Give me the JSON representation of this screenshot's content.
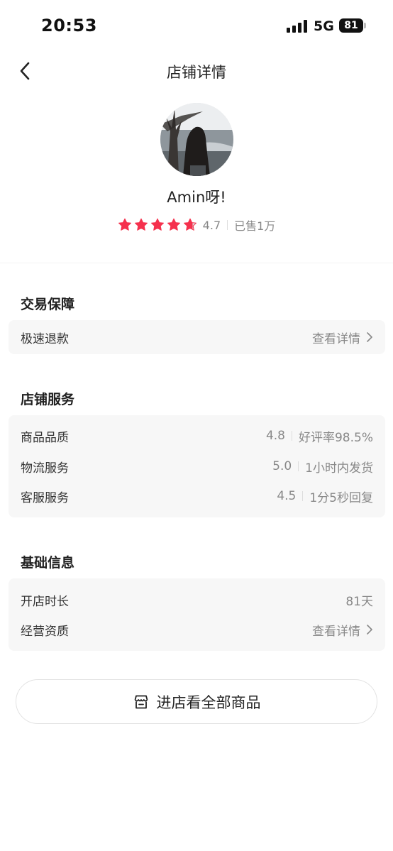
{
  "status_bar": {
    "time": "20:53",
    "network": "5G",
    "battery": "81"
  },
  "nav": {
    "title": "店铺详情"
  },
  "shop": {
    "name": "Amin呀!",
    "rating": "4.7",
    "stars": 4.7,
    "sold": "已售1万"
  },
  "guarantee": {
    "title": "交易保障",
    "item_label": "极速退款",
    "item_action": "查看详情"
  },
  "services": {
    "title": "店铺服务",
    "items": [
      {
        "label": "商品品质",
        "score": "4.8",
        "note": "好评率98.5%"
      },
      {
        "label": "物流服务",
        "score": "5.0",
        "note": "1小时内发货"
      },
      {
        "label": "客服服务",
        "score": "4.5",
        "note": "1分5秒回复"
      }
    ]
  },
  "basic": {
    "title": "基础信息",
    "open_label": "开店时长",
    "open_value": "81天",
    "qual_label": "经营资质",
    "qual_action": "查看详情"
  },
  "enter_button": {
    "label": "进店看全部商品"
  },
  "colors": {
    "star": "#f5314d",
    "star_empty": "#dddddd"
  }
}
